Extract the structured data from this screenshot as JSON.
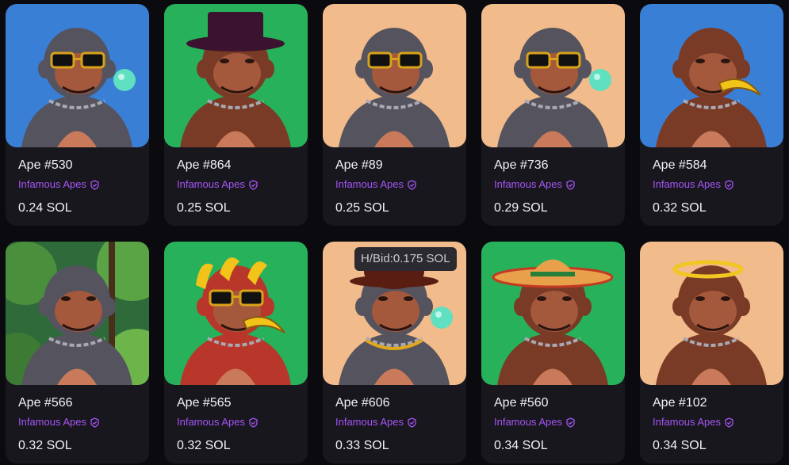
{
  "listings": [
    {
      "name": "Ape #530",
      "collection": "Infamous Apes",
      "price": "0.24 SOL",
      "bg": "#3a7fd6",
      "fur": "#55535e",
      "accessory": "sunglasses-bubble"
    },
    {
      "name": "Ape #864",
      "collection": "Infamous Apes",
      "price": "0.25 SOL",
      "bg": "#27b15a",
      "fur": "#7a3b26",
      "accessory": "top-hat"
    },
    {
      "name": "Ape #89",
      "collection": "Infamous Apes",
      "price": "0.25 SOL",
      "bg": "#f1bb8b",
      "fur": "#55535e",
      "accessory": "sunglasses"
    },
    {
      "name": "Ape #736",
      "collection": "Infamous Apes",
      "price": "0.29 SOL",
      "bg": "#f1bb8b",
      "fur": "#55535e",
      "accessory": "sunglasses-bubble"
    },
    {
      "name": "Ape #584",
      "collection": "Infamous Apes",
      "price": "0.32 SOL",
      "bg": "#3a7fd6",
      "fur": "#7a3b26",
      "accessory": "banana-mouth"
    },
    {
      "name": "Ape #566",
      "collection": "Infamous Apes",
      "price": "0.32 SOL",
      "bg": "#2f6b3a",
      "fur": "#55535e",
      "accessory": "jungle"
    },
    {
      "name": "Ape #565",
      "collection": "Infamous Apes",
      "price": "0.32 SOL",
      "bg": "#27b15a",
      "fur": "#b8372a",
      "accessory": "banana-crown"
    },
    {
      "name": "Ape #606",
      "collection": "Infamous Apes",
      "price": "0.33 SOL",
      "bg": "#f1bb8b",
      "fur": "#55535e",
      "accessory": "bowler-hat"
    },
    {
      "name": "Ape #560",
      "collection": "Infamous Apes",
      "price": "0.34 SOL",
      "bg": "#27b15a",
      "fur": "#7a3b26",
      "accessory": "sombrero"
    },
    {
      "name": "Ape #102",
      "collection": "Infamous Apes",
      "price": "0.34 SOL",
      "bg": "#f1bb8b",
      "fur": "#7a3b26",
      "accessory": "halo"
    }
  ],
  "tooltip": {
    "text": "H/Bid:0.175 SOL"
  },
  "colors": {
    "accent": "#a855f7",
    "card": "#17171d",
    "page": "#0b0b0f"
  }
}
